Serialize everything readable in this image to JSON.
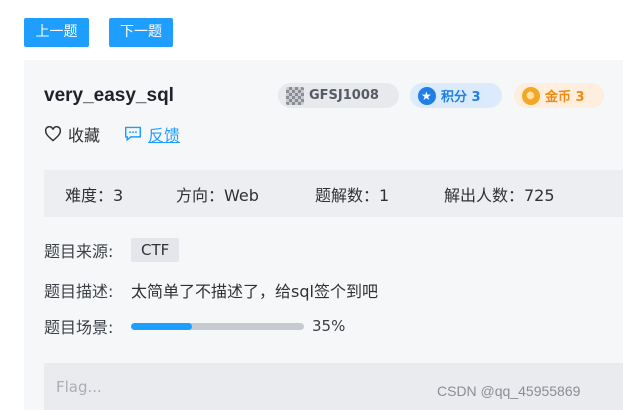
{
  "nav": {
    "prev_label": "上一题",
    "next_label": "下一题"
  },
  "challenge": {
    "title": "very_easy_sql",
    "tags": {
      "id": "GFSJ1008",
      "score": "积分 3",
      "coin": "金币 3"
    },
    "actions": {
      "favorite": "收藏",
      "feedback": "反馈"
    },
    "stats": {
      "difficulty": "难度：3",
      "direction": "方向：Web",
      "solves": "题解数：1",
      "solvers": "解出人数：725"
    },
    "source_label": "题目来源:",
    "source_value": "CTF",
    "desc_label": "题目描述:",
    "desc_value": "太简单了不描述了，给sql签个到吧",
    "scene_label": "题目场景:",
    "scene_progress": 0.35,
    "scene_progress_text": "35%",
    "flag_placeholder": "Flag..."
  },
  "watermark": "CSDN @qq_45955869",
  "colors": {
    "accent": "#1e9fff",
    "score": "#1e7fe6",
    "coin": "#f08a14"
  }
}
